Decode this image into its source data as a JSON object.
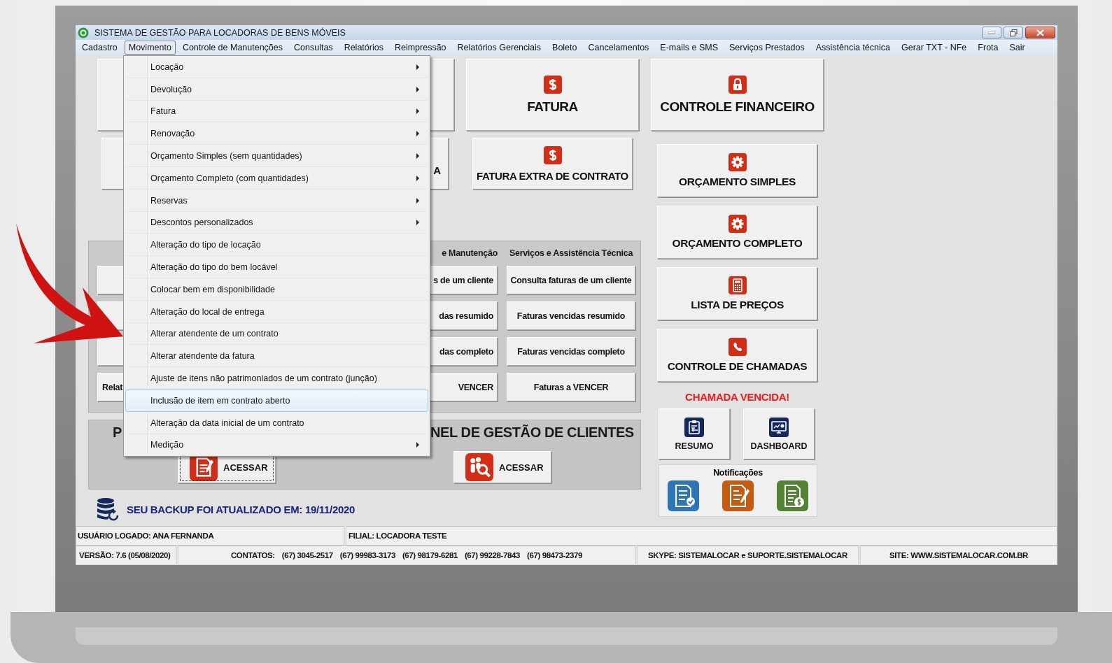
{
  "window": {
    "title": "SISTEMA DE GESTÃO PARA LOCADORAS DE BENS MÓVEIS"
  },
  "menu_bar": [
    {
      "label": "Cadastro",
      "selected": false
    },
    {
      "label": "Movimento",
      "selected": true
    },
    {
      "label": "Controle de Manutenções",
      "selected": false
    },
    {
      "label": "Consultas",
      "selected": false
    },
    {
      "label": "Relatórios",
      "selected": false
    },
    {
      "label": "Reimpressão",
      "selected": false
    },
    {
      "label": "Relatórios Gerenciais",
      "selected": false
    },
    {
      "label": "Boleto",
      "selected": false
    },
    {
      "label": "Cancelamentos",
      "selected": false
    },
    {
      "label": "E-mails e SMS",
      "selected": false
    },
    {
      "label": "Serviços Prestados",
      "selected": false
    },
    {
      "label": "Assistência técnica",
      "selected": false
    },
    {
      "label": "Gerar TXT - NFe",
      "selected": false
    },
    {
      "label": "Frota",
      "selected": false
    },
    {
      "label": "Sair",
      "selected": false
    }
  ],
  "open_menu": {
    "items": [
      {
        "label": "Locação",
        "submenu": true,
        "selected": false
      },
      {
        "label": "Devolução",
        "submenu": true,
        "selected": false
      },
      {
        "label": "Fatura",
        "submenu": true,
        "selected": false
      },
      {
        "label": "Renovação",
        "submenu": true,
        "selected": false
      },
      {
        "label": "Orçamento Simples (sem quantidades)",
        "submenu": true,
        "selected": false
      },
      {
        "label": "Orçamento Completo (com quantidades)",
        "submenu": true,
        "selected": false
      },
      {
        "label": "Reservas",
        "submenu": true,
        "selected": false
      },
      {
        "label": "Descontos personalizados",
        "submenu": true,
        "selected": false
      },
      {
        "label": "Alteração do tipo de locação",
        "submenu": false,
        "selected": false
      },
      {
        "label": "Alteração do tipo do bem locável",
        "submenu": false,
        "selected": false
      },
      {
        "label": "Colocar bem em disponibilidade",
        "submenu": false,
        "selected": false
      },
      {
        "label": "Alteração do local de entrega",
        "submenu": false,
        "selected": false
      },
      {
        "label": "Alterar atendente de um contrato",
        "submenu": false,
        "selected": false
      },
      {
        "label": "Alterar atendente da fatura",
        "submenu": false,
        "selected": false
      },
      {
        "label": "Ajuste de itens não patrimoniados de um contrato (junção)",
        "submenu": false,
        "selected": false
      },
      {
        "label": "Inclusão de item em contrato aberto",
        "submenu": false,
        "selected": true
      },
      {
        "label": "Alteração da data inicial de um contrato",
        "submenu": false,
        "selected": false
      },
      {
        "label": "Medição",
        "submenu": true,
        "selected": false
      }
    ]
  },
  "shortcuts": {
    "covered_fragment": "A",
    "fatura": "FATURA",
    "fatura_extra": "FATURA EXTRA DE CONTRATO"
  },
  "side_buttons": [
    {
      "kind": "large",
      "label": "CONTROLE FINANCEIRO"
    },
    {
      "kind": "small",
      "label": "ORÇAMENTO SIMPLES"
    },
    {
      "kind": "small",
      "label": "ORÇAMENTO COMPLETO"
    },
    {
      "kind": "small",
      "label": "LISTA DE PREÇOS"
    },
    {
      "kind": "small",
      "label": "CONTROLE DE CHAMADAS"
    }
  ],
  "alert": "CHAMADA VENCIDA!",
  "small_buttons": [
    {
      "label": "RESUMO"
    },
    {
      "label": "DASHBOARD"
    }
  ],
  "notifications": {
    "title": "Notificações",
    "icons": [
      {
        "color": "#2e75b6"
      },
      {
        "color": "#c55a11"
      },
      {
        "color": "#548235"
      }
    ]
  },
  "reports_panel": {
    "left_fragment": "Relat",
    "columns": [
      {
        "header": "e Manutenção",
        "buttons": [
          "s de um cliente",
          "das resumido",
          "das completo",
          "VENCER"
        ]
      },
      {
        "header": "Serviços e Assistência Técnica",
        "buttons": [
          "Consulta faturas de um cliente",
          "Faturas vencidas resumido",
          "Faturas vencidas completo",
          "Faturas a VENCER"
        ]
      }
    ]
  },
  "clients_panel": [
    {
      "title": "P",
      "button": "ACESSAR",
      "focused": true
    },
    {
      "title": "NEL DE GESTÃO DE CLIENTES",
      "button": "ACESSAR",
      "focused": false
    }
  ],
  "backup": "SEU BACKUP FOI ATUALIZADO EM: 19/11/2020",
  "status_bar": {
    "user": "USUÁRIO LOGADO: ANA FERNANDA",
    "branch": "FILIAL: LOCADORA TESTE",
    "version": "VERSÃO: 7.6 (05/08/2020)",
    "contacts_label": "CONTATOS:",
    "phones": [
      "(67) 3045-2517",
      "(67) 99983-3173",
      "(67) 98179-6281",
      "(67) 99228-7843",
      "(67) 98473-2379"
    ],
    "skype": "SKYPE: SISTEMALOCAR e SUPORTE.SISTEMALOCAR",
    "site": "SITE: WWW.SISTEMALOCAR.COM.BR"
  }
}
